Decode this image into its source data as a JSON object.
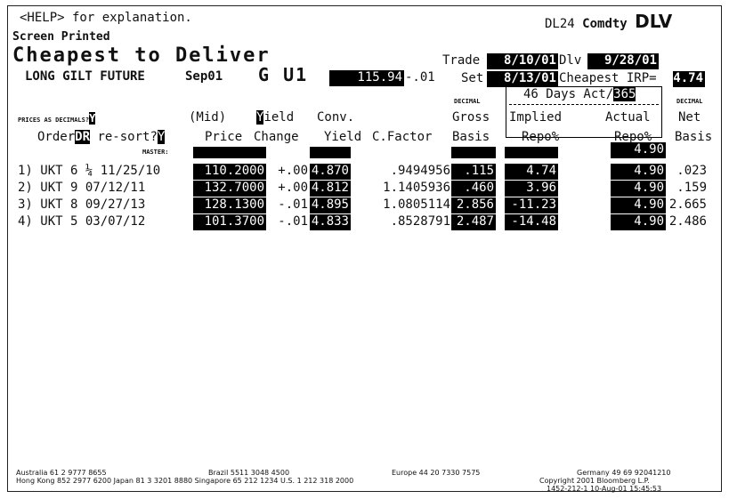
{
  "header": {
    "help": "<HELP> for explanation.",
    "screen_printed": "Screen Printed",
    "code_prefix": "DL24",
    "code_mid": "Comdty",
    "code_cmd": "DLV",
    "title": "Cheapest to Deliver"
  },
  "contract": {
    "name": "LONG GILT FUTURE",
    "month": "Sep01",
    "ticker": "G U1",
    "price": "115.94",
    "change": "-.01"
  },
  "dates": {
    "trade_label": "Trade",
    "trade": "8/10/01",
    "dlv_label": "Dlv",
    "dlv": "9/28/01",
    "set_label": "Set",
    "set": "8/13/01",
    "cheapest_irp_label": "Cheapest IRP=",
    "cheapest_irp": "4.74",
    "days_label_pre": "46 Days Act/",
    "days_basis": "365"
  },
  "options": {
    "prices_as_decimals_label": "PRICES AS DECIMALS?",
    "prices_as_decimals": "Y",
    "order_label": "Order",
    "order_value": "DR",
    "resort_label": " re-sort?",
    "resort_value": "Y",
    "master_label": "MASTER:"
  },
  "columns": {
    "mid": "(Mid)",
    "price": "Price",
    "yield_flag": "Y",
    "yield_rest": "ield",
    "change": "Change",
    "conv_top": "Conv.",
    "conv_bottom": "Yield",
    "cfactor": "C.Factor",
    "decimal1": "DECIMAL",
    "gross": "Gross",
    "basis": "Basis",
    "implied": "Implied",
    "implied_repo": "Repo%",
    "actual": "Actual",
    "actual_repo": "Repo%",
    "decimal2": "DECIMAL",
    "net": "Net",
    "net_basis": "Basis"
  },
  "master_actual_repo": "4.90",
  "rows": [
    {
      "bond": "1) UKT 6 ¼ 11/25/10",
      "price": "110.2000",
      "change": "+.00",
      "yield": "4.870",
      "cfactor": ".9494956",
      "gross": ".115",
      "implied": "4.74",
      "actual": "4.90",
      "net": ".023"
    },
    {
      "bond": "2) UKT 9 07/12/11",
      "price": "132.7000",
      "change": "+.00",
      "yield": "4.812",
      "cfactor": "1.1405936",
      "gross": ".460",
      "implied": "3.96",
      "actual": "4.90",
      "net": ".159"
    },
    {
      "bond": "3) UKT 8 09/27/13",
      "price": "128.1300",
      "change": "-.01",
      "yield": "4.895",
      "cfactor": "1.0805114",
      "gross": "2.856",
      "implied": "-11.23",
      "actual": "4.90",
      "net": "2.665"
    },
    {
      "bond": "4) UKT 5 03/07/12",
      "price": "101.3700",
      "change": "-.01",
      "yield": "4.833",
      "cfactor": ".8528791",
      "gross": "2.487",
      "implied": "-14.48",
      "actual": "4.90",
      "net": "2.486"
    }
  ],
  "footer": {
    "line1a": "Australia 61 2 9777 8655",
    "line1b": "Brazil 5511 3048 4500",
    "line1c": "Europe 44 20 7330 7575",
    "line1d": "Germany 49 69 92041210",
    "line2a": "Hong Kong 852 2977 6200 Japan 81 3 3201 8880 Singapore 65 212 1234 U.S. 1 212 318 2000",
    "line2b": "Copyright 2001 Bloomberg L.P.",
    "line3": "1452-212-1 10-Aug-01 15:45:53"
  }
}
